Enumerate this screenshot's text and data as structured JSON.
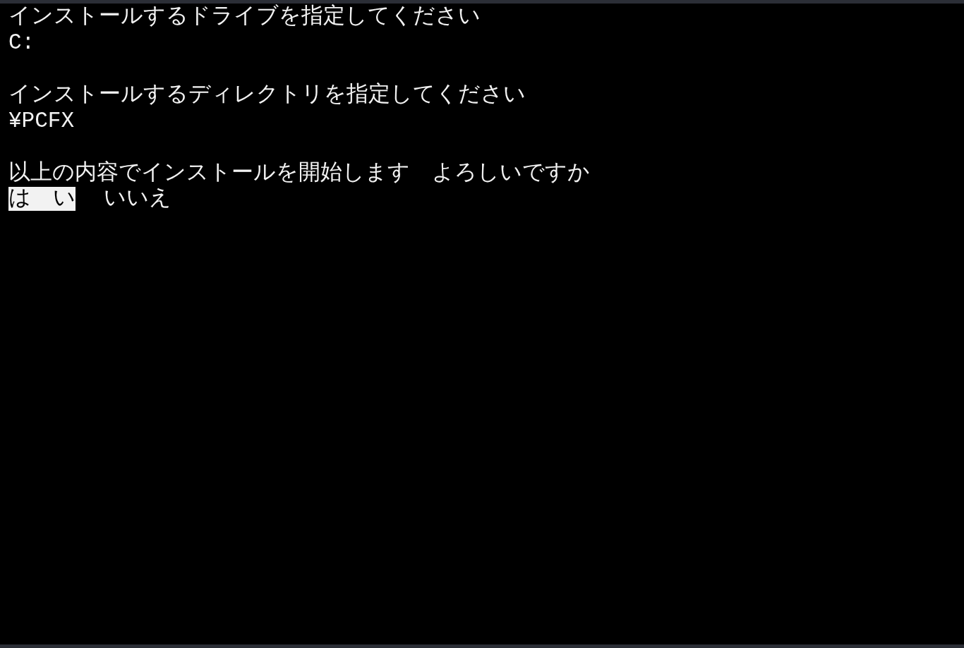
{
  "steps": [
    {
      "prompt": "インストールするドライブを指定してください",
      "value": "C:"
    },
    {
      "prompt": "インストールするディレクトリを指定してください",
      "value": "¥PCFX"
    }
  ],
  "question": "以上の内容でインストールを開始します　よろしいですか",
  "choices": [
    {
      "label": "は　い",
      "selected": true
    },
    {
      "label": "いいえ",
      "selected": false
    }
  ]
}
